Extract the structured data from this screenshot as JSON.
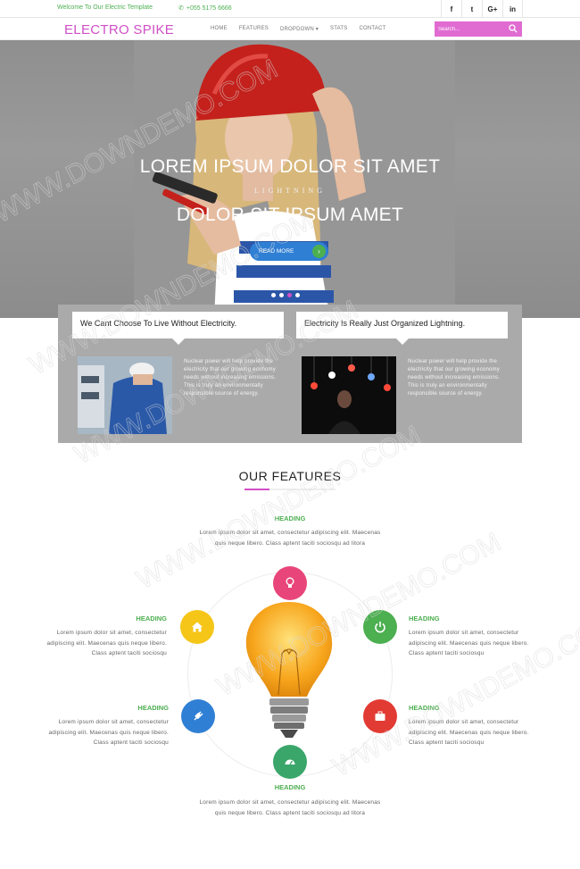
{
  "topbar": {
    "welcome": "Welcome To Our Electric Template",
    "phone": "+055 5175 6666",
    "social": [
      "f",
      "t",
      "G+",
      "in"
    ]
  },
  "nav": {
    "logo": "ELECTRO SPIKE",
    "items": [
      "HOME",
      "FEATURES",
      "DROPDOWN ▾",
      "STATS",
      "CONTACT"
    ],
    "search_placeholder": "Search..."
  },
  "hero": {
    "title1": "LOREM IPSUM DOLOR SIT AMET",
    "subtitle": "LIGHTNING",
    "title2": "DOLOR SIT IPSUM AMET",
    "button": "READ MORE",
    "button_arrow": "›",
    "active_slide": 3
  },
  "info": {
    "quote1": "We Cant Choose To Live Without Electricity.",
    "quote2": "Electricity Is Really Just Organized Lightning.",
    "text1": "Nuclear power will help provide the electricity that our growing economy needs without increasing emissions. This is truly an environmentally responsible source of energy.",
    "text2": "Nuclear power will help provide the electricity that our growing economy needs without increasing emissions. This is truly an environmentally responsible source of energy."
  },
  "features": {
    "title": "OUR FEATURES",
    "top": {
      "heading": "HEADING",
      "text": "Lorem ipsum dolor sit amet, consectetur adipiscing elit. Maecenas quis neque libero. Class aptent taciti sociosqu ad litora"
    },
    "left1": {
      "heading": "HEADING",
      "text": "Lorem ipsum dolor sit amet, consectetur adipiscing elit. Maecenas quis neque libero. Class aptent taciti sociosqu"
    },
    "left2": {
      "heading": "HEADING",
      "text": "Lorem ipsum dolor sit amet, consectetur adipiscing elit. Maecenas quis neque libero. Class aptent taciti sociosqu"
    },
    "right1": {
      "heading": "HEADING",
      "text": "Lorem ipsum dolor sit amet, consectetur adipiscing elit. Maecenas quis neque libero. Class aptent taciti sociosqu"
    },
    "right2": {
      "heading": "HEADING",
      "text": "Lorem ipsum dolor sit amet, consectetur adipiscing elit. Maecenas quis neque libero. Class aptent taciti sociosqu"
    },
    "bottom": {
      "heading": "HEADING",
      "text": "Lorem ipsum dolor sit amet, consectetur adipiscing elit. Maecenas quis neque libero. Class aptent taciti sociosqu ad litora"
    },
    "icons": {
      "top": {
        "name": "lightbulb-icon",
        "color": "#e8467a"
      },
      "left1": {
        "name": "home-icon",
        "color": "#f5c518"
      },
      "left2": {
        "name": "plug-icon",
        "color": "#2f7fd4"
      },
      "right1": {
        "name": "power-icon",
        "color": "#4caf50"
      },
      "right2": {
        "name": "briefcase-icon",
        "color": "#e23b34"
      },
      "bottom": {
        "name": "dashboard-icon",
        "color": "#3aa66a"
      }
    }
  },
  "watermark": "WWW.DOWNDEMO.COM",
  "colors": {
    "brand": "#d14fc8",
    "green": "#4caf50",
    "blue": "#2f7fd4"
  }
}
